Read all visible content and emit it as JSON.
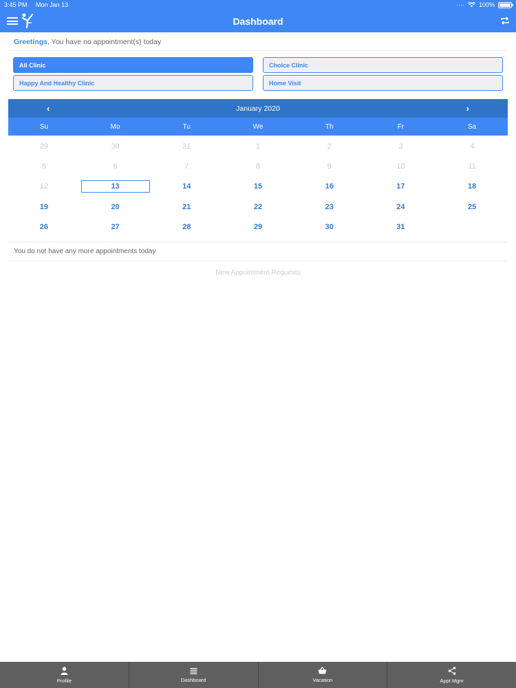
{
  "status_bar": {
    "time": "3:45 PM",
    "date": "Mon Jan 13",
    "battery": "100%",
    "battery_level": 1.0
  },
  "nav": {
    "title": "Dashboard"
  },
  "greeting": {
    "highlight": "Greetings",
    "message": ", You have no appointment(s) today"
  },
  "clinics": [
    {
      "label": "All Clinic",
      "active": true
    },
    {
      "label": "Choice Clinic",
      "active": false
    },
    {
      "label": "Happy And Healthy Clinic",
      "active": false
    },
    {
      "label": "Home Visit",
      "active": false
    }
  ],
  "calendar": {
    "month_label": "January 2020",
    "weekdays": [
      "Su",
      "Mo",
      "Tu",
      "We",
      "Th",
      "Fr",
      "Sa"
    ],
    "selected": "13",
    "days": [
      {
        "d": "29",
        "muted": true
      },
      {
        "d": "30",
        "muted": true
      },
      {
        "d": "31",
        "muted": true
      },
      {
        "d": "1",
        "muted": true
      },
      {
        "d": "2",
        "muted": true
      },
      {
        "d": "3",
        "muted": true
      },
      {
        "d": "4",
        "muted": true
      },
      {
        "d": "5",
        "muted": true
      },
      {
        "d": "6",
        "muted": true
      },
      {
        "d": "7",
        "muted": true
      },
      {
        "d": "8",
        "muted": true
      },
      {
        "d": "9",
        "muted": true
      },
      {
        "d": "10",
        "muted": true
      },
      {
        "d": "11",
        "muted": true
      },
      {
        "d": "12",
        "muted": true
      },
      {
        "d": "13",
        "muted": false
      },
      {
        "d": "14",
        "muted": false
      },
      {
        "d": "15",
        "muted": false
      },
      {
        "d": "16",
        "muted": false
      },
      {
        "d": "17",
        "muted": false
      },
      {
        "d": "18",
        "muted": false
      },
      {
        "d": "19",
        "muted": false
      },
      {
        "d": "20",
        "muted": false
      },
      {
        "d": "21",
        "muted": false
      },
      {
        "d": "22",
        "muted": false
      },
      {
        "d": "23",
        "muted": false
      },
      {
        "d": "24",
        "muted": false
      },
      {
        "d": "25",
        "muted": false
      },
      {
        "d": "26",
        "muted": false
      },
      {
        "d": "27",
        "muted": false
      },
      {
        "d": "28",
        "muted": false
      },
      {
        "d": "29",
        "muted": false
      },
      {
        "d": "30",
        "muted": false
      },
      {
        "d": "31",
        "muted": false
      },
      {
        "d": "",
        "muted": false
      }
    ]
  },
  "appointments": {
    "none_text": "You do not have any more appointments today",
    "new_requests": "New Appointment Requests"
  },
  "tabs": [
    {
      "label": "Profile",
      "icon": "person-icon"
    },
    {
      "label": "Dashboard",
      "icon": "list-icon"
    },
    {
      "label": "Vacation",
      "icon": "basket-icon"
    },
    {
      "label": "Appt Mgnr",
      "icon": "share-icon"
    }
  ],
  "colors": {
    "primary": "#3f87f5",
    "calendar_header": "#2f74c6",
    "tab_bar": "#5f5f5f"
  }
}
